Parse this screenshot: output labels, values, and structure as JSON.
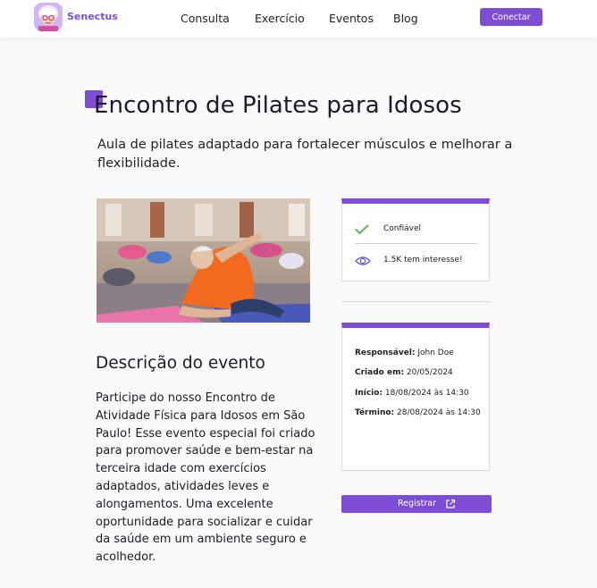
{
  "header": {
    "brand": "Senectus",
    "nav": [
      "Consulta",
      "Exercício",
      "Eventos",
      "Blog"
    ],
    "connect_label": "Conectar"
  },
  "event": {
    "title": "Encontro de Pilates para Idosos",
    "subtitle": "Aula de pilates adaptado para fortalecer músculos e melhorar a flexibilidade.",
    "description_heading": "Descrição do evento",
    "description": "Participe do nosso Encontro de Atividade Física para Idosos em São Paulo! Esse evento especial foi criado para promover saúde e bem-estar na terceira idade com exercícios adaptados, atividades leves e alongamentos. Uma excelente oportunidade para socializar e cuidar da saúde em um ambiente seguro e acolhedor."
  },
  "stats": {
    "trusted_label": "Confiável",
    "interest_label": "1.5K tem interesse!"
  },
  "details": {
    "responsible_label": "Responsável:",
    "responsible_value": " John Doe",
    "created_label": "Criado em:",
    "created_value": " 20/05/2024",
    "start_label": "Início:",
    "start_value": " 18/08/2024 às 14:30",
    "end_label": "Término:",
    "end_value": " 28/08/2024 às 14:30"
  },
  "register_label": "Registrar",
  "colors": {
    "accent": "#7e4dd6",
    "check": "#5cb85c",
    "eye": "#6a55d8"
  },
  "icons": {
    "check": "check-icon",
    "eye": "eye-icon",
    "external": "external-link-icon"
  }
}
